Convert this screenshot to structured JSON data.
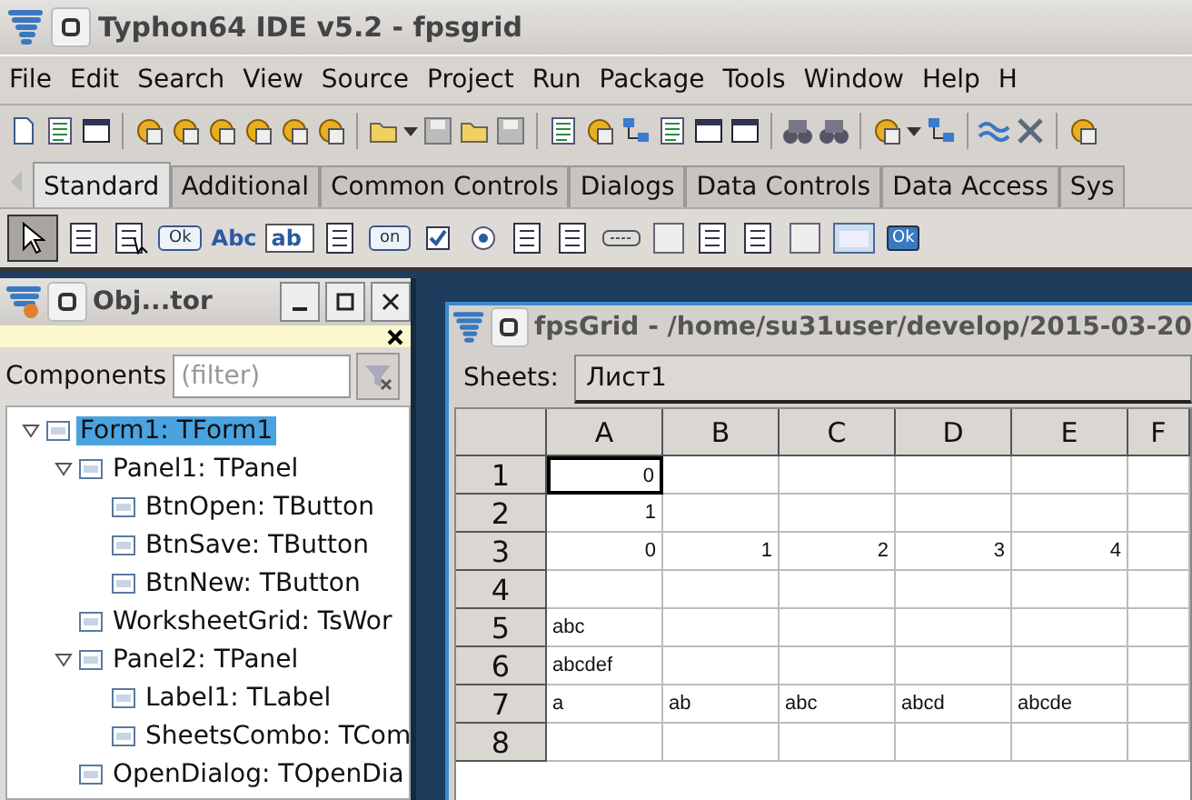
{
  "window": {
    "title": "Typhon64 IDE v5.2 - fpsgrid"
  },
  "menu": [
    "File",
    "Edit",
    "Search",
    "View",
    "Source",
    "Project",
    "Run",
    "Package",
    "Tools",
    "Window",
    "Help",
    "H"
  ],
  "component_tabs": [
    {
      "label": "Standard",
      "selected": true
    },
    {
      "label": "Additional",
      "selected": false
    },
    {
      "label": "Common Controls",
      "selected": false
    },
    {
      "label": "Dialogs",
      "selected": false
    },
    {
      "label": "Data Controls",
      "selected": false
    },
    {
      "label": "Data Access",
      "selected": false
    },
    {
      "label": "Sys",
      "selected": false
    }
  ],
  "palette": [
    {
      "kind": "pointer",
      "selected": true
    },
    {
      "kind": "menu",
      "selected": false
    },
    {
      "kind": "popup",
      "selected": false
    },
    {
      "kind": "button",
      "text": "Ok",
      "selected": false
    },
    {
      "kind": "label",
      "text": "Abc",
      "selected": false
    },
    {
      "kind": "edit",
      "text": "ab",
      "selected": false
    },
    {
      "kind": "memo",
      "selected": false
    },
    {
      "kind": "button",
      "text": "on",
      "selected": false
    },
    {
      "kind": "check",
      "selected": false
    },
    {
      "kind": "radio",
      "selected": false
    },
    {
      "kind": "list",
      "selected": false
    },
    {
      "kind": "menu",
      "selected": false
    },
    {
      "kind": "scroll",
      "selected": false
    },
    {
      "kind": "panel",
      "selected": false
    },
    {
      "kind": "list",
      "selected": false
    },
    {
      "kind": "list",
      "selected": false
    },
    {
      "kind": "panel",
      "selected": false
    },
    {
      "kind": "frame",
      "selected": false
    },
    {
      "kind": "actions",
      "text": "Ok",
      "selected": false
    }
  ],
  "object_inspector": {
    "title": "Obj...tor",
    "filter_label": "Components",
    "filter": {
      "placeholder": "(filter)"
    },
    "tree": [
      {
        "label": "Form1: TForm1",
        "selected": true,
        "expanded": true,
        "children": [
          {
            "label": "Panel1: TPanel",
            "selected": false,
            "expanded": true,
            "children": [
              {
                "label": "BtnOpen: TButton",
                "selected": false
              },
              {
                "label": "BtnSave: TButton",
                "selected": false
              },
              {
                "label": "BtnNew: TButton",
                "selected": false
              }
            ]
          },
          {
            "label": "WorksheetGrid: TsWor",
            "selected": false
          },
          {
            "label": "Panel2: TPanel",
            "selected": false,
            "expanded": true,
            "children": [
              {
                "label": "Label1: TLabel",
                "selected": false
              },
              {
                "label": "SheetsCombo: TCom",
                "selected": false
              }
            ]
          },
          {
            "label": "OpenDialog: TOpenDia",
            "selected": false
          }
        ]
      }
    ]
  },
  "form_window": {
    "title": "fpsGrid - /home/su31user/develop/2015-03-20",
    "sheets_label": "Sheets:",
    "sheet": "Лист1",
    "columns": [
      "A",
      "B",
      "C",
      "D",
      "E",
      "F"
    ],
    "rows": [
      {
        "header": "1",
        "cells": [
          {
            "text": "0",
            "kind": "number",
            "selected": true
          }
        ]
      },
      {
        "header": "2",
        "cells": [
          {
            "text": "1",
            "kind": "number",
            "selected": false
          }
        ]
      },
      {
        "header": "3",
        "cells": [
          {
            "text": "0",
            "kind": "number",
            "selected": false
          },
          {
            "text": "1",
            "kind": "number",
            "selected": false
          },
          {
            "text": "2",
            "kind": "number",
            "selected": false
          },
          {
            "text": "3",
            "kind": "number",
            "selected": false
          },
          {
            "text": "4",
            "kind": "number",
            "selected": false
          }
        ]
      },
      {
        "header": "4",
        "cells": []
      },
      {
        "header": "5",
        "cells": [
          {
            "text": "abc",
            "kind": "text",
            "selected": false
          }
        ]
      },
      {
        "header": "6",
        "cells": [
          {
            "text": "abcdef",
            "kind": "text",
            "selected": false
          }
        ]
      },
      {
        "header": "7",
        "cells": [
          {
            "text": "a",
            "kind": "text",
            "selected": false
          },
          {
            "text": "ab",
            "kind": "text",
            "selected": false
          },
          {
            "text": "abc",
            "kind": "text",
            "selected": false
          },
          {
            "text": "abcd",
            "kind": "text",
            "selected": false
          },
          {
            "text": "abcde",
            "kind": "text",
            "selected": false
          }
        ]
      },
      {
        "header": "8",
        "cells": []
      }
    ]
  }
}
